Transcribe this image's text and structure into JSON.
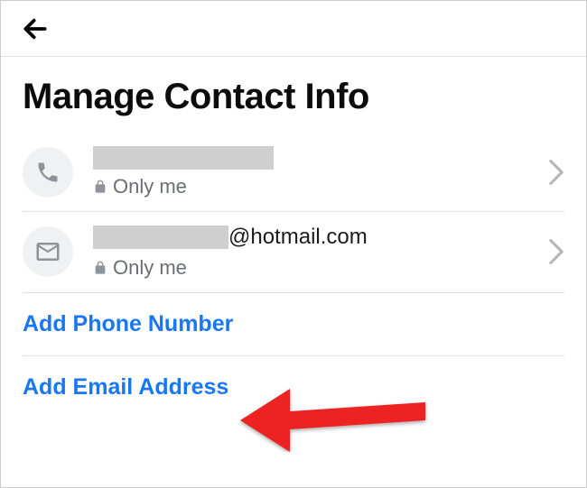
{
  "header": {
    "title": "Manage Contact Info"
  },
  "contacts": {
    "phone": {
      "value_suffix": "",
      "privacy": "Only me"
    },
    "email": {
      "value_suffix": "@hotmail.com",
      "privacy": "Only me"
    }
  },
  "actions": {
    "add_phone": "Add Phone Number",
    "add_email": "Add Email Address"
  }
}
